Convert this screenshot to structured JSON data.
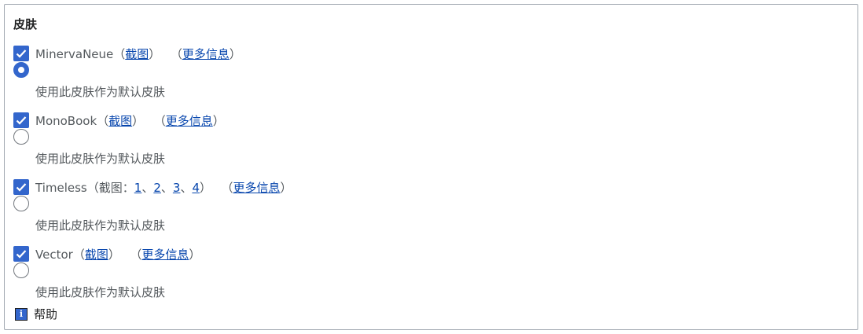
{
  "section": {
    "title": "皮肤"
  },
  "skins": [
    {
      "name": "MinervaNeue",
      "enabled": true,
      "default": true,
      "open_paren": "（",
      "screenshot_link": "截图",
      "close_paren": "）",
      "more_info_link": "更多信息",
      "default_label": "使用此皮肤作为默认皮肤"
    },
    {
      "name": "MonoBook",
      "enabled": true,
      "default": false,
      "open_paren": "（",
      "screenshot_link": "截图",
      "close_paren": "）",
      "more_info_link": "更多信息",
      "default_label": "使用此皮肤作为默认皮肤"
    },
    {
      "name": "Timeless",
      "enabled": true,
      "default": false,
      "screenshots_prefix": "（截图：",
      "screenshot_numbers": [
        "1",
        "2",
        "3",
        "4"
      ],
      "number_separator": "、",
      "close_paren": "）",
      "more_info_link": "更多信息",
      "default_label": "使用此皮肤作为默认皮肤"
    },
    {
      "name": "Vector",
      "enabled": true,
      "default": false,
      "open_paren": "（",
      "screenshot_link": "截图",
      "close_paren": "）",
      "more_info_link": "更多信息",
      "default_label": "使用此皮肤作为默认皮肤"
    }
  ],
  "more_info_paren_open": "（",
  "more_info_paren_close": "）",
  "help": {
    "icon": "info-icon",
    "icon_glyph": "i",
    "label": "帮助"
  },
  "colors": {
    "accent": "#3366cc",
    "link": "#0645ad",
    "border": "#a2a9b1",
    "text_muted": "#54595d"
  }
}
